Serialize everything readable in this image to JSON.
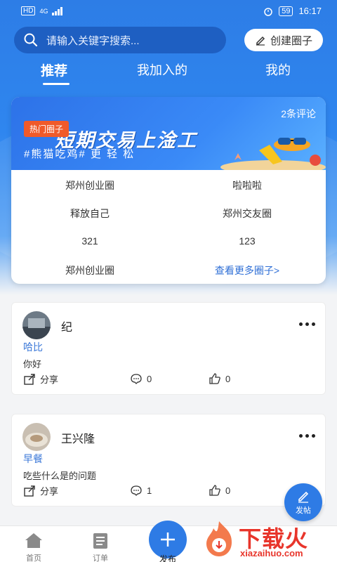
{
  "status_bar": {
    "left": "HD 4G",
    "battery": "59",
    "time": "16:17"
  },
  "search": {
    "placeholder": "请输入关键字搜索..."
  },
  "create_button": "创建圈子",
  "tabs": [
    {
      "label": "推荐",
      "active": true
    },
    {
      "label": "我加入的",
      "active": false
    },
    {
      "label": "我的",
      "active": false
    }
  ],
  "hot_card": {
    "comments": "2条评论",
    "tag": "热门圈子",
    "banner_title": "短期交易上淦工",
    "banner_sub": "#熊猫吃鸡#   更 轻 松",
    "circles": [
      "郑州创业圈",
      "啦啦啦",
      "释放自己",
      "郑州交友圈",
      "321",
      "123",
      "郑州创业圈"
    ],
    "more_link": "查看更多圈子>"
  },
  "posts": [
    {
      "name": "纪",
      "tag": "哈比",
      "content": "你好",
      "share": "分享",
      "comments": "0",
      "likes": "0"
    },
    {
      "name": "王兴隆",
      "tag": "早餐",
      "content": "吃些什么是的问题",
      "share": "分享",
      "comments": "1",
      "likes": "0"
    }
  ],
  "fab_label": "发帖",
  "bottom_nav": {
    "home": "首页",
    "orders": "订单",
    "publish": "发布"
  },
  "watermark": {
    "cn": "下载火",
    "en": "xiazaihuo.com"
  },
  "colors": {
    "primary": "#2e7be5",
    "hot_tag": "#f05a2a",
    "link": "#2f6fd6"
  }
}
